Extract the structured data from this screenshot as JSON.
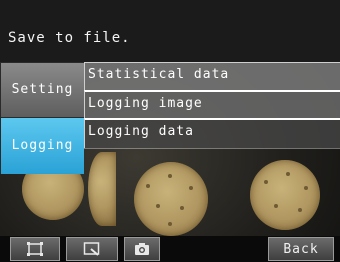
{
  "header": {
    "title": "Save to file."
  },
  "tabs": [
    {
      "label": "Setting",
      "active": false
    },
    {
      "label": "Logging",
      "active": true
    }
  ],
  "menu": {
    "items": [
      {
        "label": "Statistical data"
      },
      {
        "label": "Logging image"
      },
      {
        "label": "Logging data"
      }
    ]
  },
  "toolbar": {
    "buttons": [
      {
        "icon": "frame-icon"
      },
      {
        "icon": "zoom-window-icon"
      },
      {
        "icon": "camera-icon"
      }
    ],
    "back_label": "Back"
  },
  "colors": {
    "active_tab": "#2aa2d6",
    "inactive_tab": "#6e6e6e",
    "header_bg": "#1b1b1b"
  }
}
